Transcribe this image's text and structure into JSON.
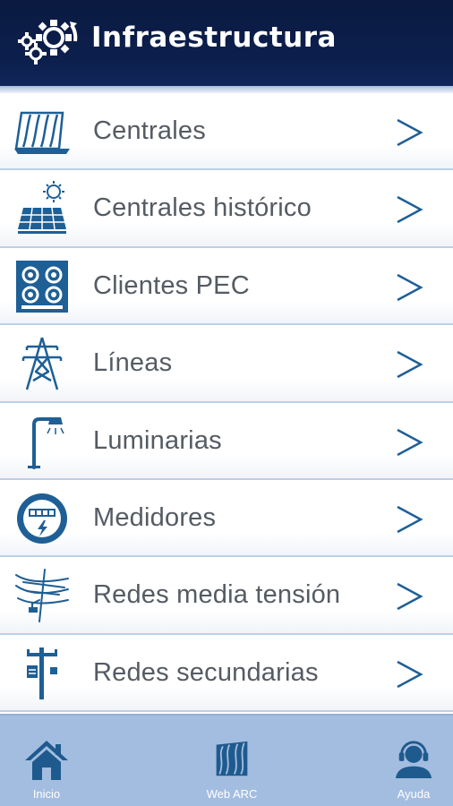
{
  "header": {
    "title": "Infraestructura",
    "icon": "gears-icon",
    "background": "#0c1f4d"
  },
  "menu": {
    "chevron": ">",
    "items": [
      {
        "label": "Centrales",
        "icon": "hydro-dam-icon"
      },
      {
        "label": "Centrales histórico",
        "icon": "solar-panel-icon"
      },
      {
        "label": "Clientes PEC",
        "icon": "induction-cooktop-icon"
      },
      {
        "label": "Líneas",
        "icon": "transmission-tower-icon"
      },
      {
        "label": "Luminarias",
        "icon": "street-lamp-icon"
      },
      {
        "label": "Medidores",
        "icon": "electric-meter-icon"
      },
      {
        "label": "Redes media tensión",
        "icon": "medium-voltage-pole-icon"
      },
      {
        "label": "Redes secundarias",
        "icon": "secondary-pole-icon"
      }
    ]
  },
  "tabbar": {
    "background": "#a3bde0",
    "tabs": [
      {
        "label": "Inicio",
        "icon": "home-icon"
      },
      {
        "label": "Web ARC",
        "icon": "arc-logo-icon"
      },
      {
        "label": "Ayuda",
        "icon": "support-agent-icon"
      }
    ]
  },
  "colors": {
    "icon_blue": "#1e5f96",
    "label_gray": "#555b63",
    "divider": "#bcd0e8",
    "tab_icon": "#1f5a8e"
  }
}
